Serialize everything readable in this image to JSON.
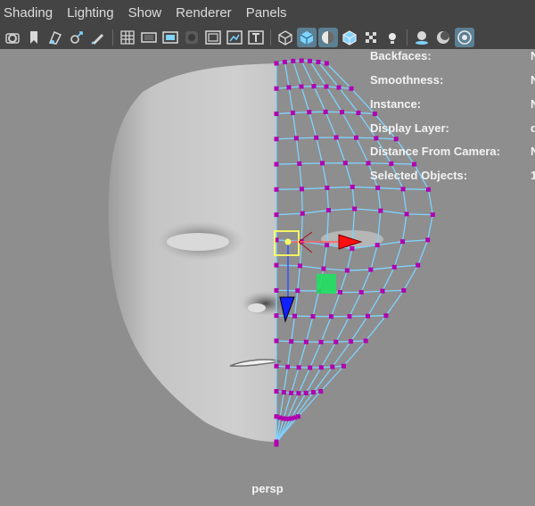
{
  "menu": [
    "Shading",
    "Lighting",
    "Show",
    "Renderer",
    "Panels"
  ],
  "toolbar_icons": [
    "camera-attributes-icon",
    "bookmark-icon",
    "image-plane-icon",
    "camera-track-icon",
    "grease-pencil-icon",
    "grid-icon",
    "film-gate-icon",
    "resolution-gate-icon",
    "gate-mask-icon",
    "field-chart-icon",
    "safe-action-icon",
    "safe-title-icon",
    "wireframe-icon",
    "smooth-shade-icon",
    "default-material-icon",
    "wireframe-on-shaded-icon",
    "textured-icon",
    "use-all-lights-icon",
    "shadows-icon",
    "screen-space-ao-icon",
    "motion-blur-icon",
    "isolate-select-icon"
  ],
  "hud": {
    "rows": [
      {
        "label": "Backfaces:",
        "value": "N"
      },
      {
        "label": "Smoothness:",
        "value": "N"
      },
      {
        "label": "Instance:",
        "value": "N"
      },
      {
        "label": "Display Layer:",
        "value": "d"
      },
      {
        "label": "Distance From Camera:",
        "value": "N"
      },
      {
        "label": "Selected Objects:",
        "value": "1"
      }
    ]
  },
  "camera_label": "persp",
  "colors": {
    "ui_bg": "#444444",
    "viewport_bg": "#8e8e8e",
    "wire": "#7fd3ff",
    "vertex": "#b000b0",
    "manip_x": "#ff1010",
    "manip_y": "#20e060",
    "manip_z": "#1020ff",
    "active_button": "#5b7f93"
  }
}
